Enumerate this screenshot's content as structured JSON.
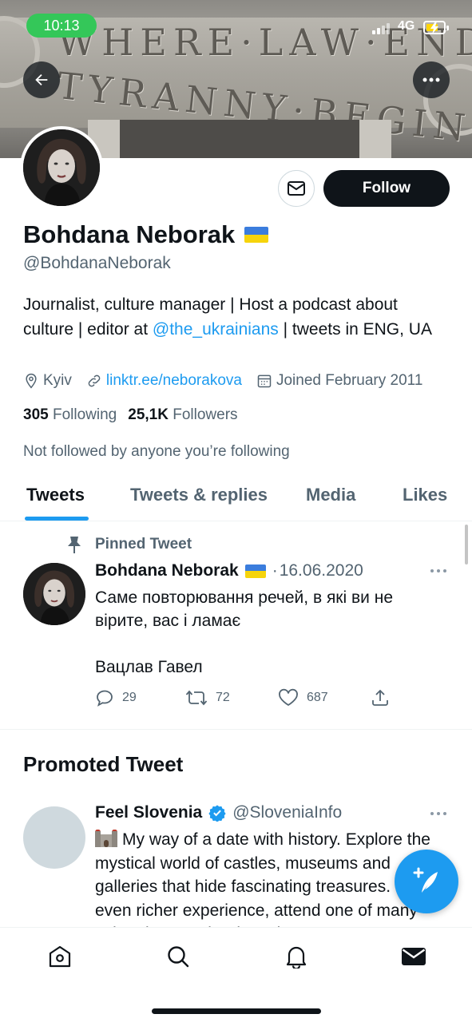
{
  "status_bar": {
    "time": "10:13",
    "network": "4G"
  },
  "banner": {
    "engraving_line1": "WHERE·LAW·ENDS",
    "engraving_line2": "TYRANNY·BEGINS"
  },
  "header_buttons": {
    "back_icon": "arrow-left-icon",
    "more_icon": "more-horizontal-icon"
  },
  "profile": {
    "name": "Bohdana Neborak",
    "handle": "@BohdanaNeborak",
    "bio": {
      "text_before": "Journalist, culture manager | Host a podcast about culture | editor at ",
      "mention": "@the_ukrainians",
      "text_after": " | tweets in ENG, UA"
    },
    "location": "Kyiv",
    "website": "linktr.ee/neborakova",
    "joined": "Joined February 2011",
    "following_count": "305",
    "following_label": "Following",
    "followers_count": "25,1K",
    "followers_label": "Followers",
    "not_followed_text": "Not followed by anyone you’re following",
    "follow_button": "Follow"
  },
  "tabs": [
    {
      "label": "Tweets",
      "active": true
    },
    {
      "label": "Tweets & replies",
      "active": false
    },
    {
      "label": "Media",
      "active": false
    },
    {
      "label": "Likes",
      "active": false
    }
  ],
  "pinned_tweet": {
    "pinned_label": "Pinned Tweet",
    "author": "Bohdana Neborak",
    "date": "16.06.2020",
    "lines": [
      "Саме повторювання речей, в які ви не вірите, вас і ламає",
      "Вацлав Гавел"
    ],
    "replies": "29",
    "retweets": "72",
    "likes": "687"
  },
  "promoted": {
    "section_title": "Promoted Tweet",
    "author": "Feel Slovenia",
    "handle": "@SloveniaInfo",
    "text": "My way of a date with history. Explore the mystical world of castles, museums and galleries that hide fascinating treasures. For an even richer experience, attend one of many cultural events in Slovenia."
  },
  "colors": {
    "accent": "#1d9bf0",
    "text": "#0f1419",
    "secondary": "#536471",
    "status_green": "#34c759"
  },
  "bottom_nav": [
    "home-icon",
    "search-icon",
    "notifications-icon",
    "messages-icon"
  ]
}
